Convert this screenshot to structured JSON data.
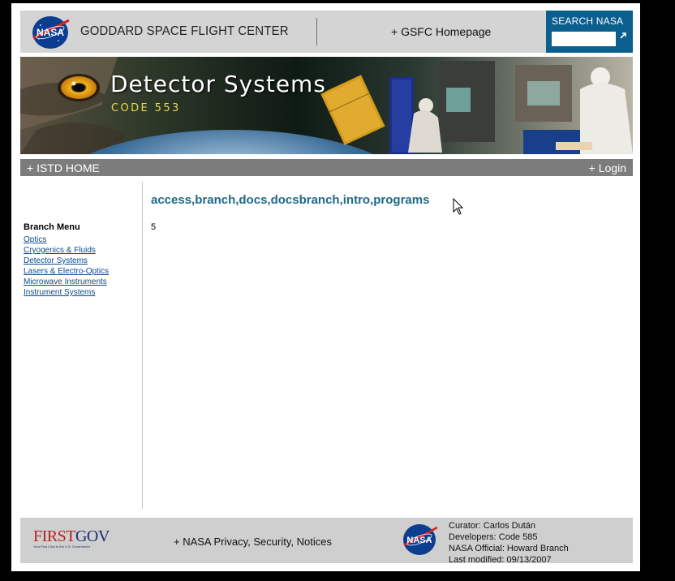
{
  "header": {
    "center_name": "GODDARD SPACE FLIGHT CENTER",
    "gsfc_link": "+ GSFC Homepage",
    "search_label": "SEARCH NASA",
    "search_value": "",
    "logo_text": "NASA"
  },
  "banner": {
    "title": "Detector Systems",
    "code": "CODE 553"
  },
  "nav": {
    "home": "+ ISTD HOME",
    "login": "+ Login"
  },
  "sidebar": {
    "title": "Branch Menu",
    "items": [
      {
        "label": "Optics"
      },
      {
        "label": "Cryogenics & Fluids"
      },
      {
        "label": "Detector Systems"
      },
      {
        "label": "Lasers & Electro-Optics"
      },
      {
        "label": "Microwave Instruments"
      },
      {
        "label": "Instrument Systems"
      }
    ]
  },
  "content": {
    "title": "access,branch,docs,docsbranch,intro,programs",
    "body": "5"
  },
  "footer": {
    "firstgov_first": "FIRST",
    "firstgov_gov": "GOV",
    "firstgov_tagline": "Your First Click to the U.S. Government",
    "privacy": "+ NASA Privacy, Security, Notices",
    "curator": "Curator: Carlos Dután",
    "developers": "Developers: Code 585",
    "official": "NASA Official: Howard Branch",
    "modified": "Last modified: 09/13/2007"
  },
  "colors": {
    "search_bg": "#0b5f8f",
    "title_color": "#1d6a88",
    "nav_bg": "#7c7c7c"
  }
}
